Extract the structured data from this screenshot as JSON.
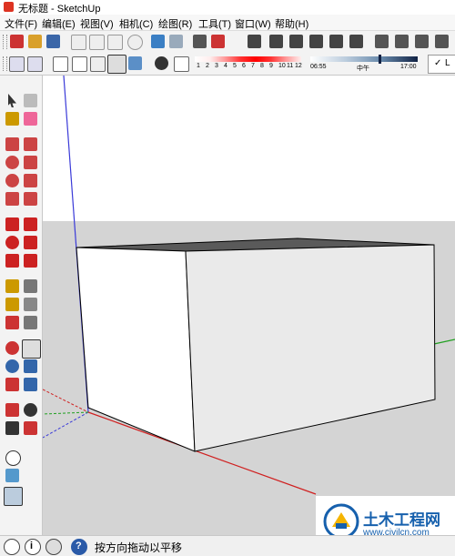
{
  "window": {
    "title": "无标题 - SketchUp"
  },
  "menu": [
    "文件(F)",
    "编辑(E)",
    "视图(V)",
    "相机(C)",
    "绘图(R)",
    "工具(T)",
    "窗口(W)",
    "帮助(H)"
  ],
  "shadow": {
    "months": [
      "1",
      "2",
      "3",
      "4",
      "5",
      "6",
      "7",
      "8",
      "9",
      "10",
      "11",
      "12"
    ],
    "time_start": "06:55",
    "time_mid": "中午",
    "time_end": "17:00"
  },
  "statusbar": {
    "hint": "按方向拖动以平移"
  },
  "watermark": {
    "name": "土木工程网",
    "url": "www.civilcn.com"
  },
  "colors": {
    "blue_axis": "#3a3ad8",
    "red_axis": "#d02020",
    "green_axis": "#20a020",
    "sky": "#ffffff",
    "ground": "#d4d4d4"
  }
}
